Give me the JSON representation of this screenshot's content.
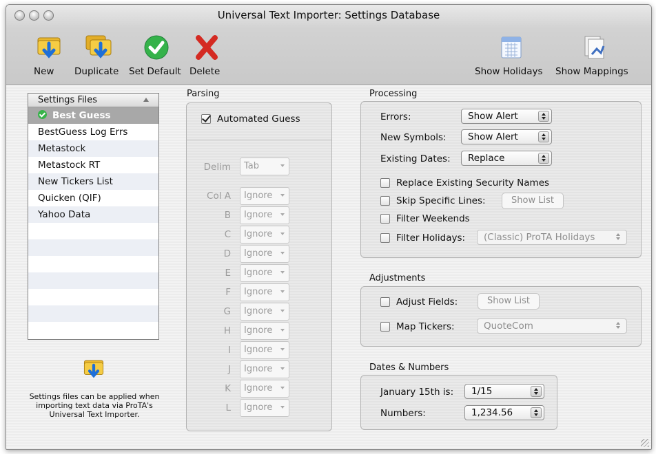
{
  "window": {
    "title": "Universal Text Importer:  Settings Database"
  },
  "toolbar": {
    "new_label": "New",
    "duplicate_label": "Duplicate",
    "set_default_label": "Set Default",
    "delete_label": "Delete",
    "show_holidays_label": "Show Holidays",
    "show_mappings_label": "Show Mappings"
  },
  "settings_files": {
    "header": "Settings Files",
    "items": [
      "Best Guess",
      "BestGuess Log Errs",
      "Metastock",
      "Metastock RT",
      "New Tickers List",
      "Quicken (QIF)",
      "Yahoo Data"
    ],
    "selected": "Best Guess"
  },
  "note": "Settings files can be applied when importing text data via ProTA's Universal Text Importer.",
  "parsing": {
    "title": "Parsing",
    "automated_guess_label": "Automated Guess",
    "automated_guess_checked": true,
    "delim_label": "Delim",
    "delim_value": "Tab",
    "columns": [
      {
        "label": "Col A",
        "value": "Ignore"
      },
      {
        "label": "B",
        "value": "Ignore"
      },
      {
        "label": "C",
        "value": "Ignore"
      },
      {
        "label": "D",
        "value": "Ignore"
      },
      {
        "label": "E",
        "value": "Ignore"
      },
      {
        "label": "F",
        "value": "Ignore"
      },
      {
        "label": "G",
        "value": "Ignore"
      },
      {
        "label": "H",
        "value": "Ignore"
      },
      {
        "label": "I",
        "value": "Ignore"
      },
      {
        "label": "J",
        "value": "Ignore"
      },
      {
        "label": "K",
        "value": "Ignore"
      },
      {
        "label": "L",
        "value": "Ignore"
      }
    ]
  },
  "processing": {
    "title": "Processing",
    "errors_label": "Errors:",
    "errors_value": "Show Alert",
    "new_symbols_label": "New Symbols:",
    "new_symbols_value": "Show Alert",
    "existing_dates_label": "Existing Dates:",
    "existing_dates_value": "Replace",
    "replace_names_label": "Replace Existing Security Names",
    "skip_lines_label": "Skip Specific Lines:",
    "show_list_label": "Show List",
    "filter_weekends_label": "Filter Weekends",
    "filter_holidays_label": "Filter Holidays:",
    "holidays_value": "(Classic) ProTA Holidays"
  },
  "adjustments": {
    "title": "Adjustments",
    "adjust_fields_label": "Adjust Fields:",
    "show_list_label": "Show List",
    "map_tickers_label": "Map Tickers:",
    "map_tickers_value": "QuoteCom"
  },
  "dates_numbers": {
    "title": "Dates & Numbers",
    "jan15_label": "January 15th is:",
    "jan15_value": "1/15",
    "numbers_label": "Numbers:",
    "numbers_value": "1,234.56"
  }
}
